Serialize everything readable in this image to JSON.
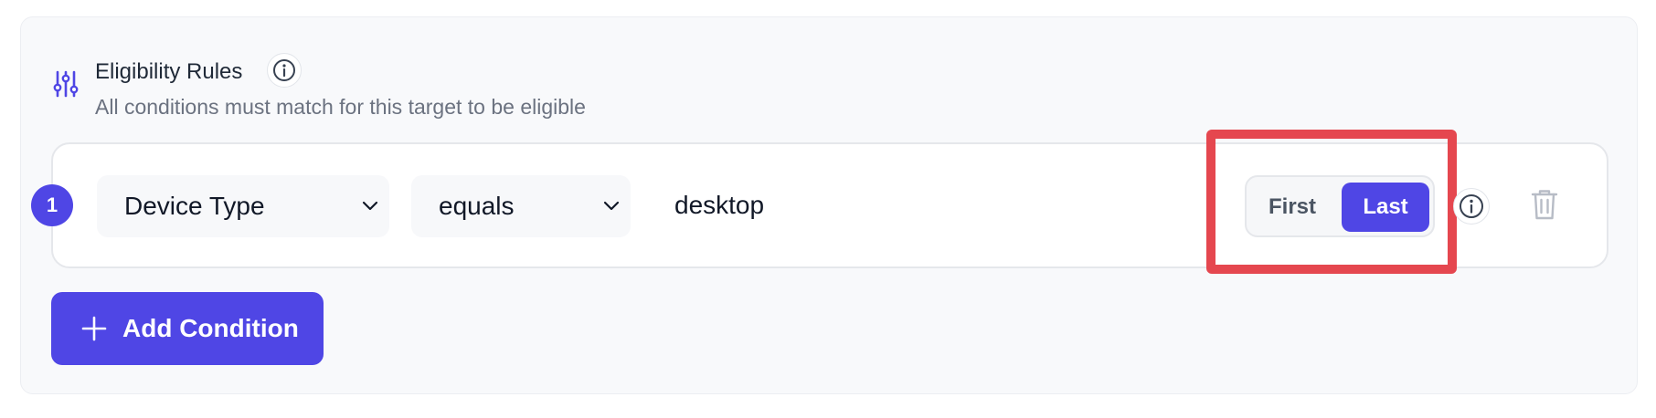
{
  "header": {
    "icon": "sliders-icon",
    "title": "Eligibility Rules",
    "info_icon": "info-icon",
    "subtitle": "All conditions must match for this target to be eligible"
  },
  "conditions": [
    {
      "number": "1",
      "field": "Device Type",
      "operator": "equals",
      "value": "desktop",
      "position_toggle": {
        "options": [
          "First",
          "Last"
        ],
        "selected": "Last"
      },
      "info_icon": "info-icon",
      "delete_icon": "trash-icon"
    }
  ],
  "actions": {
    "add_condition_label": "Add Condition",
    "add_icon": "plus-icon"
  },
  "colors": {
    "accent": "#4f46e5",
    "highlight_box": "#e5474f",
    "panel_bg": "#f8f9fb"
  }
}
